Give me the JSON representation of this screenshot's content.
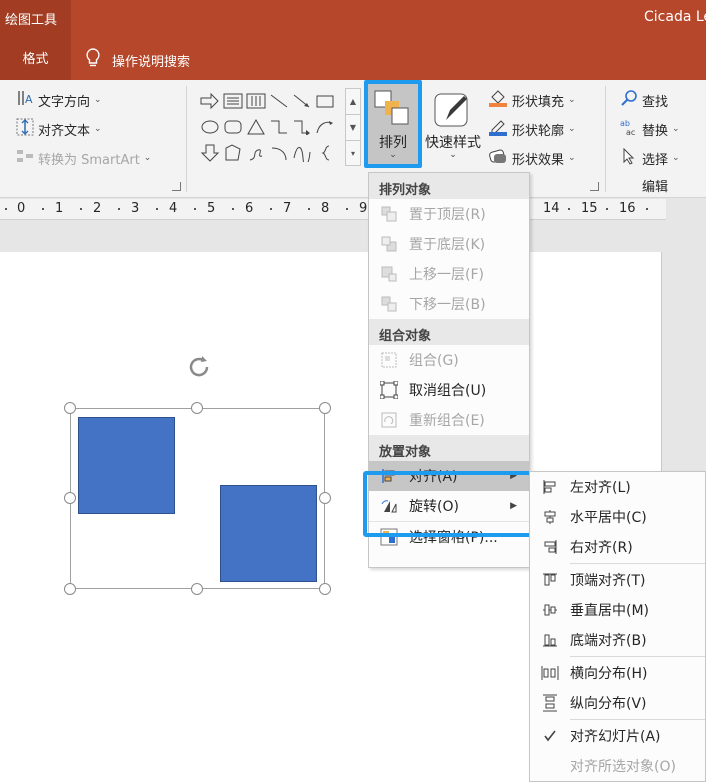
{
  "title_bar": {
    "context_tool": "绘图工具",
    "user": "Cicada Le"
  },
  "tabs": {
    "format": "格式",
    "tell_me": "操作说明搜索"
  },
  "ribbon": {
    "text_direction": "文字方向",
    "align_text": "对齐文本",
    "convert_smartart": "转换为 SmartArt",
    "arrange": "排列",
    "quick_styles": "快速样式",
    "shape_fill": "形状填充",
    "shape_outline": "形状轮廓",
    "shape_effects": "形状效果",
    "find": "查找",
    "replace": "替换",
    "select": "选择",
    "editing": "编辑"
  },
  "ruler": {
    "ticks": [
      "0",
      "1",
      "2",
      "3",
      "4",
      "5",
      "6",
      "7",
      "8",
      "9",
      "14",
      "15",
      "16"
    ]
  },
  "arrange_menu": {
    "header_order": "排列对象",
    "bring_front": "置于顶层(R)",
    "send_back": "置于底层(K)",
    "bring_forward": "上移一层(F)",
    "send_backward": "下移一层(B)",
    "header_group": "组合对象",
    "group": "组合(G)",
    "ungroup": "取消组合(U)",
    "regroup": "重新组合(E)",
    "header_position": "放置对象",
    "align": "对齐(A)",
    "rotate": "旋转(O)",
    "selection_pane": "选择窗格(P)..."
  },
  "align_submenu": {
    "align_left": "左对齐(L)",
    "align_center": "水平居中(C)",
    "align_right": "右对齐(R)",
    "align_top": "顶端对齐(T)",
    "align_middle": "垂直居中(M)",
    "align_bottom": "底端对齐(B)",
    "distribute_h": "横向分布(H)",
    "distribute_v": "纵向分布(V)",
    "align_to_slide": "对齐幻灯片(A)",
    "align_selected": "对齐所选对象(O)"
  },
  "colors": {
    "accent": "#b7472a",
    "highlight": "#1e9bef",
    "shape_fill": "#4472c4"
  }
}
